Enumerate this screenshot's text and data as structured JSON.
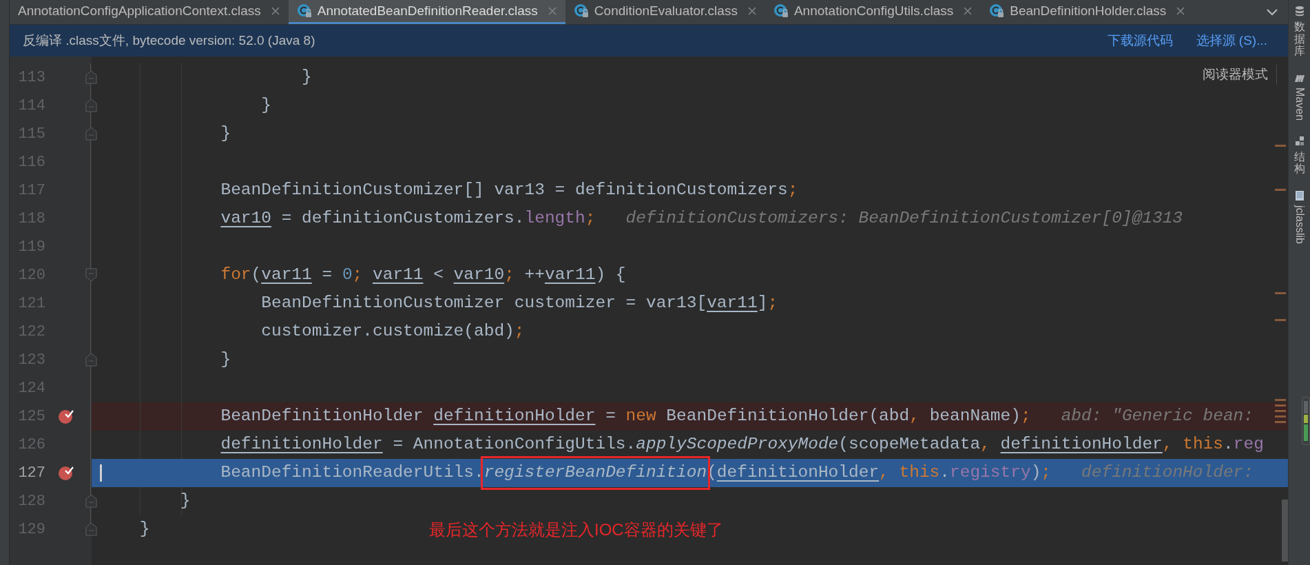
{
  "tabs": [
    {
      "label": "AnnotationConfigApplicationContext.class",
      "selected": false,
      "icon": false
    },
    {
      "label": "AnnotatedBeanDefinitionReader.class",
      "selected": true,
      "icon": true
    },
    {
      "label": "ConditionEvaluator.class",
      "selected": false,
      "icon": true
    },
    {
      "label": "AnnotationConfigUtils.class",
      "selected": false,
      "icon": true
    },
    {
      "label": "BeanDefinitionHolder.class",
      "selected": false,
      "icon": true
    }
  ],
  "banner": {
    "message": "反编译 .class文件, bytecode version: 52.0 (Java 8)",
    "links": [
      "下载源代码",
      "选择源 (S)..."
    ]
  },
  "reader_mode": "阅读器模式",
  "lines": [
    {
      "number": "113",
      "kind": "fold_end",
      "breakpoint": false,
      "current": false,
      "code": [
        {
          "kind": "plain",
          "text": "                    }"
        }
      ]
    },
    {
      "number": "114",
      "kind": "fold_end",
      "breakpoint": false,
      "current": false,
      "code": [
        {
          "kind": "plain",
          "text": "                }"
        }
      ]
    },
    {
      "number": "115",
      "kind": "fold_end",
      "breakpoint": false,
      "current": false,
      "code": [
        {
          "kind": "plain",
          "text": "            }"
        }
      ]
    },
    {
      "number": "116",
      "kind": "plain",
      "breakpoint": false,
      "current": false
    },
    {
      "number": "117",
      "kind": "plain",
      "breakpoint": false,
      "current": false,
      "code": [
        {
          "kind": "plain",
          "text": "            BeanDefinitionCustomizer[] var13 = definitionCustomizers"
        },
        {
          "kind": "keyword",
          "text": ";"
        }
      ]
    },
    {
      "number": "118",
      "kind": "plain",
      "breakpoint": false,
      "current": false,
      "code": [
        {
          "kind": "reassigned",
          "text": "            var10"
        },
        {
          "kind": "plain",
          "text": " = definitionCustomizers."
        },
        {
          "kind": "field",
          "text": "length"
        },
        {
          "kind": "keyword",
          "text": ";"
        }
      ],
      "hint": "definitionCustomizers: BeanDefinitionCustomizer[0]@1313"
    },
    {
      "number": "119",
      "kind": "plain",
      "breakpoint": false,
      "current": false
    },
    {
      "number": "120",
      "kind": "fold_start",
      "breakpoint": false,
      "current": false,
      "code": [
        {
          "kind": "keyword",
          "text": "            for"
        },
        {
          "kind": "plain",
          "text": "("
        },
        {
          "kind": "reassigned",
          "text": "var11"
        },
        {
          "kind": "plain",
          "text": " = "
        },
        {
          "kind": "number",
          "text": "0"
        },
        {
          "kind": "keyword",
          "text": "; "
        },
        {
          "kind": "reassigned",
          "text": "var11"
        },
        {
          "kind": "plain",
          "text": " < "
        },
        {
          "kind": "reassigned",
          "text": "var10"
        },
        {
          "kind": "keyword",
          "text": ";"
        },
        {
          "kind": "plain",
          "text": " ++"
        },
        {
          "kind": "reassigned",
          "text": "var11"
        },
        {
          "kind": "plain",
          "text": ") {"
        }
      ]
    },
    {
      "number": "121",
      "kind": "plain",
      "breakpoint": false,
      "current": false,
      "code": [
        {
          "kind": "plain",
          "text": "                BeanDefinitionCustomizer customizer = var13["
        },
        {
          "kind": "reassigned",
          "text": "var11"
        },
        {
          "kind": "plain",
          "text": "]"
        },
        {
          "kind": "keyword",
          "text": ";"
        }
      ]
    },
    {
      "number": "122",
      "kind": "plain",
      "breakpoint": false,
      "current": false,
      "code": [
        {
          "kind": "plain",
          "text": "                customizer.customize(abd)"
        },
        {
          "kind": "keyword",
          "text": ";"
        }
      ]
    },
    {
      "number": "123",
      "kind": "fold_end",
      "breakpoint": false,
      "current": false,
      "code": [
        {
          "kind": "plain",
          "text": "            }"
        }
      ]
    },
    {
      "number": "124",
      "kind": "plain",
      "breakpoint": false,
      "current": false
    },
    {
      "number": "125",
      "kind": "plain",
      "breakpoint": true,
      "current": false,
      "code": [
        {
          "kind": "plain",
          "text": "            BeanDefinitionHolder "
        },
        {
          "kind": "reassigned",
          "text": "definitionHolder"
        },
        {
          "kind": "plain",
          "text": " = "
        },
        {
          "kind": "keyword",
          "text": "new"
        },
        {
          "kind": "plain",
          "text": " BeanDefinitionHolder(abd"
        },
        {
          "kind": "keyword",
          "text": ","
        },
        {
          "kind": "plain",
          "text": " beanName)"
        },
        {
          "kind": "keyword",
          "text": ";"
        }
      ],
      "hint": "abd: \"Generic bean:"
    },
    {
      "number": "126",
      "kind": "plain",
      "breakpoint": false,
      "current": false,
      "code": [
        {
          "kind": "reassigned",
          "text": "            definitionHolder"
        },
        {
          "kind": "plain",
          "text": " = AnnotationConfigUtils."
        },
        {
          "kind": "static",
          "text": "applyScopedProxyMode"
        },
        {
          "kind": "plain",
          "text": "(scopeMetadata"
        },
        {
          "kind": "keyword",
          "text": ", "
        },
        {
          "kind": "reassigned",
          "text": "definitionHolder"
        },
        {
          "kind": "keyword",
          "text": ", this"
        },
        {
          "kind": "plain",
          "text": "."
        },
        {
          "kind": "field",
          "text": "reg"
        }
      ]
    },
    {
      "number": "127",
      "kind": "plain",
      "breakpoint": true,
      "current": true,
      "code": [
        {
          "kind": "plain",
          "text": "            BeanDefinitionReaderUtils."
        },
        {
          "kind": "static",
          "text": "registerBeanDefinition",
          "boxed": true
        },
        {
          "kind": "plain",
          "text": "("
        },
        {
          "kind": "reassigned",
          "text": "definitionHolder"
        },
        {
          "kind": "keyword",
          "text": ", this"
        },
        {
          "kind": "plain",
          "text": "."
        },
        {
          "kind": "field",
          "text": "registry"
        },
        {
          "kind": "plain",
          "text": ")"
        },
        {
          "kind": "keyword",
          "text": ";"
        }
      ],
      "hint": "definitionHolder:"
    },
    {
      "number": "128",
      "kind": "fold_end",
      "breakpoint": false,
      "current": false,
      "code": [
        {
          "kind": "plain",
          "text": "        }"
        }
      ]
    },
    {
      "number": "129",
      "kind": "fold_end",
      "breakpoint": false,
      "current": false,
      "code": [
        {
          "kind": "plain",
          "text": "    }"
        }
      ],
      "note": "最后这个方法就是注入IOC容器的关键了"
    }
  ],
  "sidebar": [
    {
      "kind": "database",
      "label": "数据库",
      "vertical_cjk": true
    },
    {
      "kind": "maven",
      "label": "Maven",
      "vertical_cjk": false
    },
    {
      "kind": "structure",
      "label": "结构",
      "vertical_cjk": true
    },
    {
      "kind": "jclasslib",
      "label": "jclasslib",
      "vertical_cjk": false
    }
  ]
}
